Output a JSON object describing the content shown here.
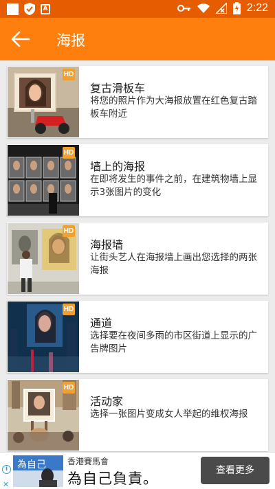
{
  "status_bar": {
    "time": "2:22",
    "app_icon_letter": "A"
  },
  "app_bar": {
    "title": "海报"
  },
  "items": [
    {
      "title": "复古滑板车",
      "description": "将您的照片作为大海报放置在红色复古踏板车附近",
      "badge": "HD"
    },
    {
      "title": "墙上的海报",
      "description": "在即将发生的事件之前，在建筑物墙上显示3张图片的变化",
      "badge": "HD"
    },
    {
      "title": "海报墙",
      "description": "让街头艺人在海报墙上画出您选择的两张海报",
      "badge": "HD"
    },
    {
      "title": "通道",
      "description": "选择要在夜间多雨的市区街道上显示的广告牌图片",
      "badge": "HD"
    },
    {
      "title": "活动家",
      "description": "选择一张图片变成女人举起的维权海报",
      "badge": "HD"
    }
  ],
  "ad": {
    "sponsor": "香港賽馬會",
    "headline": "為自己負責。",
    "cta": "查看更多",
    "info_icon": "i",
    "close_icon": "✕",
    "image_text": "為自己"
  },
  "colors": {
    "status_bar": "#e65c00",
    "app_bar": "#ff7f0e",
    "badge": "#f0a030",
    "ad_button": "#4a4a4a"
  }
}
